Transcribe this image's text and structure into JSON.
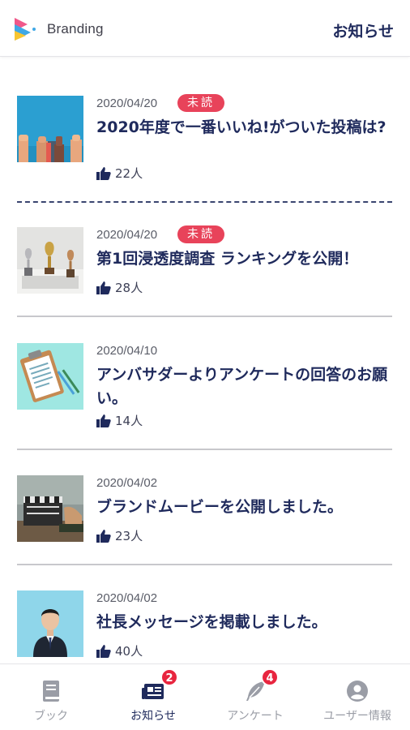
{
  "header": {
    "brand": "Branding",
    "title": "お知らせ"
  },
  "news": [
    {
      "date": "2020/04/20",
      "badge": "未読",
      "title": "2020年度で一番いいね!がついた投稿は?",
      "likes": "22人",
      "thumb": "thumbs-up-crowd"
    },
    {
      "date": "2020/04/20",
      "badge": "未読",
      "title": "第1回浸透度調査 ランキングを公開！",
      "likes": "28人",
      "thumb": "trophies"
    },
    {
      "date": "2020/04/10",
      "badge": "",
      "title": "アンバサダーよりアンケートの回答のお願い。",
      "likes": "14人",
      "thumb": "clipboard"
    },
    {
      "date": "2020/04/02",
      "badge": "",
      "title": "ブランドムービーを公開しました。",
      "likes": "23人",
      "thumb": "clapperboard"
    },
    {
      "date": "2020/04/02",
      "badge": "",
      "title": "社長メッセージを掲載しました。",
      "likes": "40人",
      "thumb": "businessman"
    }
  ],
  "tabs": [
    {
      "label": "ブック",
      "icon": "book-icon",
      "badge": ""
    },
    {
      "label": "お知らせ",
      "icon": "newspaper-icon",
      "badge": "2"
    },
    {
      "label": "アンケート",
      "icon": "quill-icon",
      "badge": "4"
    },
    {
      "label": "ユーザー情報",
      "icon": "user-circle-icon",
      "badge": ""
    }
  ],
  "colors": {
    "accent": "#1f2a5c",
    "unread_badge": "#e8435a",
    "tab_badge": "#e8253f",
    "inactive": "#9a9da6"
  }
}
